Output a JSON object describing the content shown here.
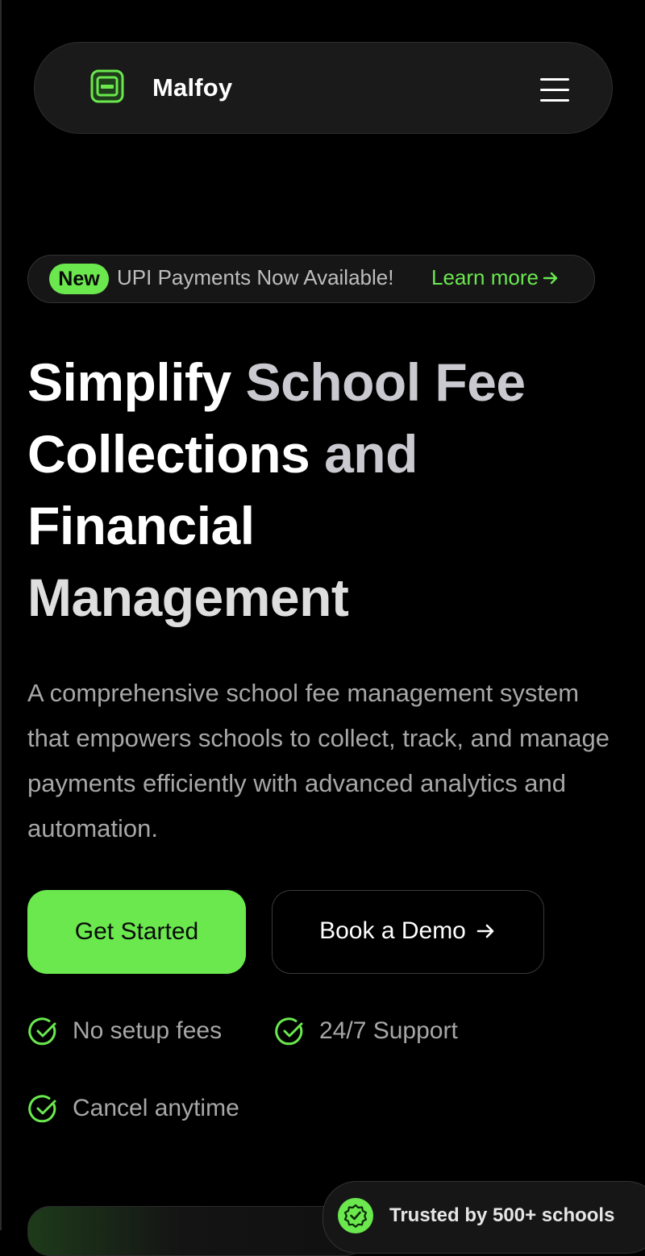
{
  "brand": {
    "name": "Malfoy",
    "logo_icon": "card-icon",
    "accent_color": "#6ae84e"
  },
  "nav": {
    "menu_icon": "hamburger-menu-icon"
  },
  "announcement": {
    "badge": "New",
    "text": "UPI Payments Now Available!",
    "link_label": "Learn more"
  },
  "hero": {
    "title_lines": [
      [
        "Simplify ",
        "School Fee"
      ],
      [
        "Collections ",
        "and"
      ],
      [
        "Financial"
      ],
      [
        "Management"
      ]
    ],
    "description": "A comprehensive school fee management system that empowers schools to collect, track, and manage payments efficiently with advanced analytics and automation."
  },
  "cta": {
    "primary_label": "Get Started",
    "secondary_label": "Book a Demo"
  },
  "features": [
    "No setup fees",
    "24/7 Support",
    "Cancel anytime"
  ],
  "trust_badge": {
    "text": "Trusted by 500+ schools",
    "icon": "verified-check-icon"
  }
}
